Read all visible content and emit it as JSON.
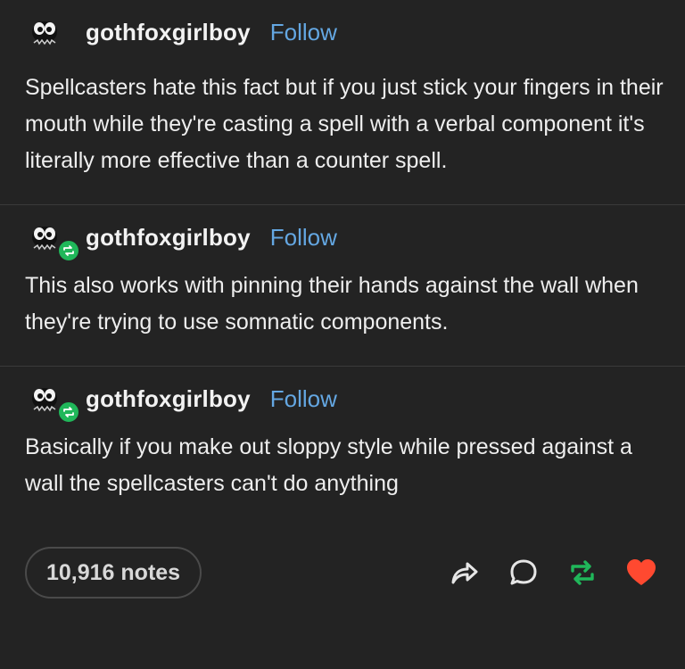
{
  "posts": [
    {
      "username": "gothfoxgirlboy",
      "follow_label": "Follow",
      "text": "Spellcasters hate this fact but if you just stick your fingers in their mouth while they're casting a spell with a verbal component it's literally more effective than a counter spell.",
      "reblog": false
    },
    {
      "username": "gothfoxgirlboy",
      "follow_label": "Follow",
      "text": "This also works with pinning their hands against the wall when they're trying to use somnatic components.",
      "reblog": true
    },
    {
      "username": "gothfoxgirlboy",
      "follow_label": "Follow",
      "text": "Basically if you make out sloppy style while pressed against a wall the spellcasters can't do anything",
      "reblog": true
    }
  ],
  "footer": {
    "notes_label": "10,916 notes"
  },
  "icons": {
    "share": "share-icon",
    "reply": "reply-icon",
    "reblog": "reblog-icon",
    "like": "heart-icon"
  },
  "colors": {
    "background": "#232323",
    "follow": "#64a7e2",
    "reblog": "#20b75a",
    "like": "#ff4930"
  }
}
